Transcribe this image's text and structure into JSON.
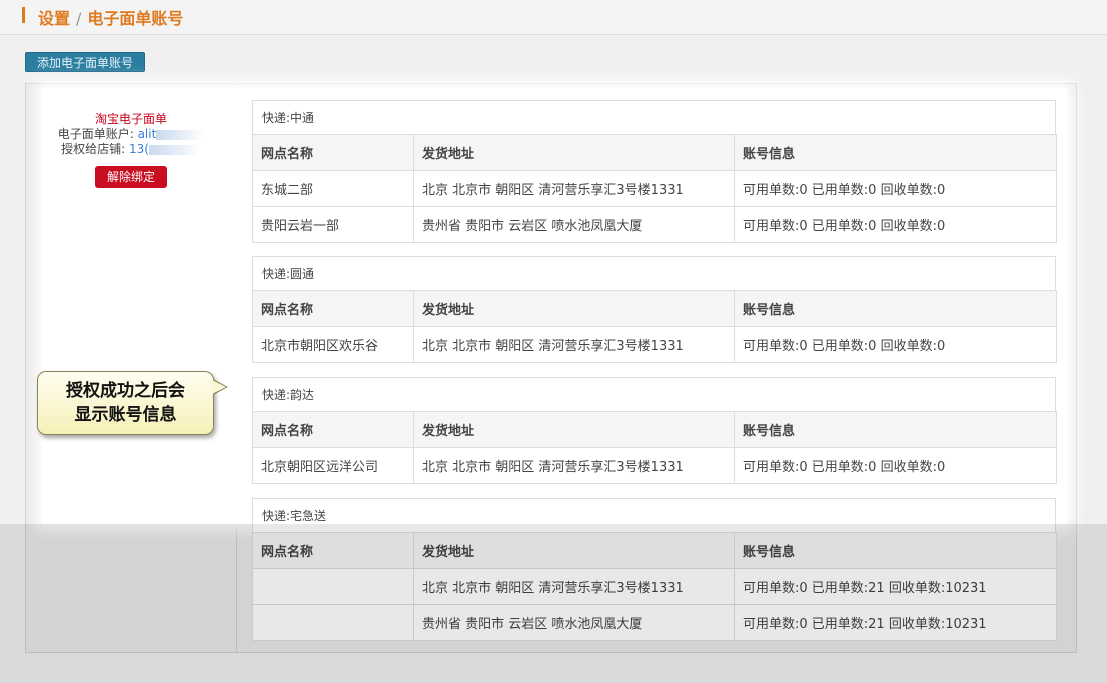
{
  "header": {
    "breadcrumb_root": "设置",
    "breadcrumb_sep": "/",
    "breadcrumb_current": "电子面单账号"
  },
  "toolbar": {
    "add_label": "添加电子面单账号"
  },
  "account": {
    "title": "淘宝电子面单",
    "account_label": "电子面单账户:",
    "account_value": "alit",
    "shop_label": "授权给店铺:",
    "shop_value": "13(",
    "unbind_label": "解除绑定"
  },
  "columns": [
    "网点名称",
    "发货地址",
    "账号信息"
  ],
  "couriers": [
    {
      "name": "快递:中通",
      "rows": [
        [
          "东城二部",
          "北京 北京市 朝阳区 清河营乐享汇3号楼1331",
          "可用单数:0 已用单数:0 回收单数:0"
        ],
        [
          "贵阳云岩一部",
          "贵州省 贵阳市 云岩区 喷水池凤凰大厦",
          "可用单数:0 已用单数:0 回收单数:0"
        ]
      ]
    },
    {
      "name": "快递:圆通",
      "rows": [
        [
          "北京市朝阳区欢乐谷",
          "北京 北京市 朝阳区 清河营乐享汇3号楼1331",
          "可用单数:0 已用单数:0 回收单数:0"
        ]
      ]
    },
    {
      "name": "快递:韵达",
      "rows": [
        [
          "北京朝阳区远洋公司",
          "北京 北京市 朝阳区 清河营乐享汇3号楼1331",
          "可用单数:0 已用单数:0 回收单数:0"
        ]
      ]
    },
    {
      "name": "快递:宅急送",
      "rows": [
        [
          "",
          "北京 北京市 朝阳区 清河营乐享汇3号楼1331",
          "可用单数:0 已用单数:21 回收单数:10231"
        ],
        [
          "",
          "贵州省 贵阳市 云岩区 喷水池凤凰大厦",
          "可用单数:0 已用单数:21 回收单数:10231"
        ]
      ]
    }
  ],
  "callout": {
    "line1": "授权成功之后会",
    "line2": "显示账号信息"
  }
}
